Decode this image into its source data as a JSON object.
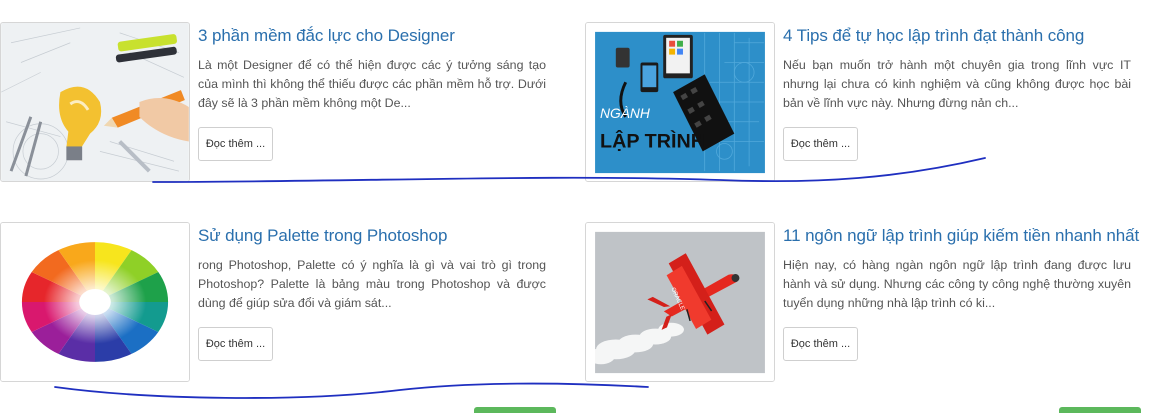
{
  "articles": [
    {
      "title": "3 phần mềm đắc lực cho Designer",
      "excerpt": "Là một Designer để có thể hiện được các ý tưởng sáng tạo của mình thì không thể thiếu được các phần mềm hỗ trợ. Dưới đây sẽ là 3 phần mềm không một De...",
      "read_more": "Đọc thêm ...",
      "image_icon": "lightbulb-sketch-image"
    },
    {
      "title": "4 Tips để tự học lập trình đạt thành công",
      "excerpt": "Nếu bạn muốn trở hành một chuyên gia trong lĩnh vực IT nhưng lại chưa có kinh nghiệm và cũng không được học bài bản về lĩnh vực này. Nhưng đừng nản ch...",
      "read_more": "Đọc thêm ...",
      "image_icon": "programming-devices-image",
      "image_text_1": "NGÀNH",
      "image_text_2": "LẬP TRÌNH"
    },
    {
      "title": "Sử dụng Palette trong Photoshop",
      "excerpt": "rong Photoshop, Palette có ý nghĩa  là gì và  vai trò gì trong Photoshop? Palette là bảng màu trong Photoshop và được dùng để giúp sửa đổi và giám sát...",
      "read_more": "Đọc thêm ...",
      "image_icon": "color-wheel-image"
    },
    {
      "title": "11 ngôn ngữ lập trình giúp kiếm tiền nhanh nhất",
      "excerpt": "Hiện nay, có hàng ngàn ngôn ngữ lập trình đang được lưu hành và sử dụng. Nhưng các công ty công nghệ thường xuyên tuyển dụng những nhà lập trình có ki...",
      "read_more": "Đọc thêm ...",
      "image_icon": "red-plane-image",
      "image_text_1": "ORACLE"
    }
  ],
  "colors": {
    "title": "#2a6fad",
    "scribble": "#1f2fc0",
    "green_button": "#5cb85c"
  }
}
